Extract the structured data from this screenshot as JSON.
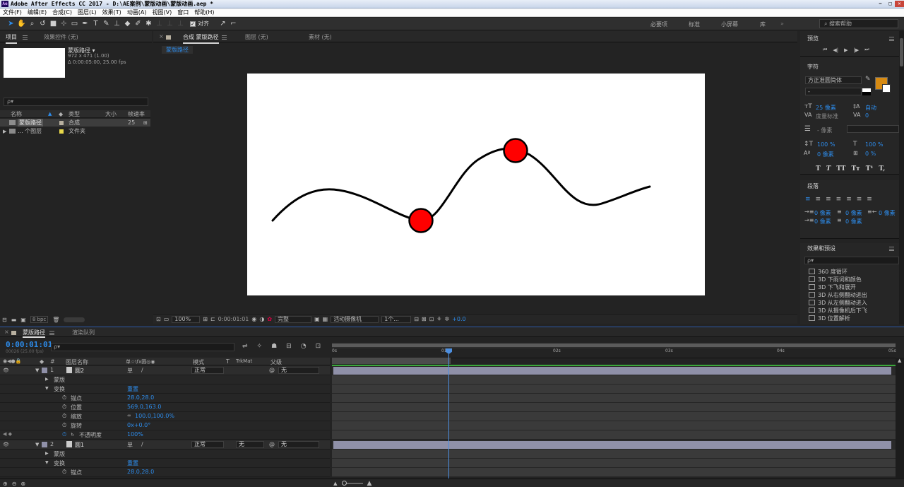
{
  "window": {
    "title": "Adobe After Effects CC 2017 - D:\\AE案例\\蒙版动画\\蒙版动画.aep *",
    "logo_text": "Ae",
    "min_label": "−",
    "max_label": "□",
    "close_label": "✕"
  },
  "menu": [
    "文件(F)",
    "编辑(E)",
    "合成(C)",
    "图层(L)",
    "效果(T)",
    "动画(A)",
    "视图(V)",
    "窗口",
    "帮助(H)"
  ],
  "toolbar": {
    "align_label": "对齐",
    "workspaces": [
      "必要项",
      "标准",
      "小屏幕",
      "库"
    ],
    "search_placeholder": "搜索帮助"
  },
  "project_panel": {
    "tabs": [
      "项目",
      "效果控件 (无)"
    ],
    "comp_name": "蒙版路径 ▾",
    "comp_size": "972 x 471 (1.00)",
    "comp_duration": "Δ 0:00:05:00, 25.00 fps",
    "search_placeholder": "ρ▾",
    "columns": [
      "名称",
      "类型",
      "大小",
      "帧速率"
    ],
    "rows": [
      {
        "name": "蒙版路径",
        "type": "合成",
        "size": "",
        "fps": "25",
        "color": "#b8b0a0"
      },
      {
        "name": "... 个图层",
        "type": "文件夹",
        "size": "",
        "fps": "",
        "color": "#e8d84a"
      }
    ],
    "bpc_label": "8 bpc"
  },
  "viewer": {
    "tabs": [
      "合成 蒙版路径",
      "图层 (无)",
      "素材 (无)"
    ],
    "sub_tab": "蒙版路径",
    "zoom": "100%",
    "timecode": "0:00:01:01",
    "resolution": "完整",
    "camera": "活动摄像机",
    "views": "1个...",
    "exposure": "+0.0"
  },
  "right_panel": {
    "preview_title": "预览",
    "preview_buttons": [
      "⏮",
      "◀|",
      "▶",
      "|▶",
      "⏭"
    ],
    "char_title": "字符",
    "font_name": "方正准圆简体",
    "font_style": "-",
    "font_size": "25 像素",
    "leading": "自动",
    "kerning": "度量标准",
    "tracking": "0",
    "stroke_width": "- 像素",
    "vscale": "100 %",
    "hscale": "100 %",
    "baseline": "0 像素",
    "tsume": "0 %",
    "text_styles": [
      "T",
      "T",
      "TT",
      "Tт",
      "T¹",
      "T,"
    ],
    "fill_color": "#d68a12",
    "para_title": "段落",
    "indent_values": [
      "0 像素",
      "0 像素",
      "0 像素",
      "0 像素",
      "0 像素"
    ],
    "effects_title": "效果和预设",
    "effects_search": "ρ▾",
    "effects": [
      "360 度循环",
      "3D 下雨词和颜色",
      "3D 下飞和展开",
      "3D 从右侧翻动进出",
      "3D 从左侧翻动进入",
      "3D 从摄像机后下飞",
      "3D 位置解析"
    ]
  },
  "timeline": {
    "tabs": [
      "蒙版路径",
      "渲染队列"
    ],
    "timecode": "0:00:01:01",
    "frame_info": "00026 (25.00 fps)",
    "search_placeholder": "ρ▾",
    "columns": [
      "#",
      "图层名称",
      "单☆\\fx圆◎◉",
      "模式",
      "T",
      "TrkMat",
      "父级"
    ],
    "ruler": [
      "0s",
      "01s",
      "02s",
      "03s",
      "04s",
      "05s"
    ],
    "layers": [
      {
        "num": "1",
        "name": "圆2",
        "mode": "正常",
        "trkmat": "",
        "parent": "无",
        "mask_label": "蒙版",
        "transform_label": "变换",
        "reset_label": "重置",
        "props": [
          {
            "name": "锚点",
            "value": "28.0,28.0"
          },
          {
            "name": "位置",
            "value": "569.0,163.0"
          },
          {
            "name": "缩放",
            "value": "100.0,100.0%"
          },
          {
            "name": "旋转",
            "value": "0x+0.0°"
          },
          {
            "name": "不透明度",
            "value": "100%"
          }
        ]
      },
      {
        "num": "2",
        "name": "圆1",
        "mode": "正常",
        "trkmat": "无",
        "parent": "无",
        "mask_label": "蒙版",
        "transform_label": "变换",
        "reset_label": "重置",
        "props": [
          {
            "name": "锚点",
            "value": "28.0,28.0"
          }
        ]
      }
    ]
  },
  "composition": {
    "stroke_color": "#000000",
    "dot_color": "#ff0000"
  }
}
